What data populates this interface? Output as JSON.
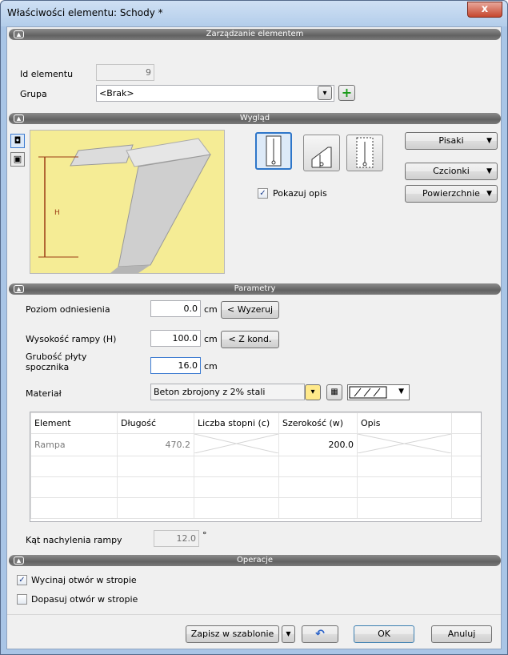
{
  "window": {
    "title": "Właściwości elementu: Schody *",
    "close_glyph": "x"
  },
  "sections": {
    "management": "Zarządzanie elementem",
    "appearance": "Wygląd",
    "parameters": "Parametry",
    "operations": "Operacje"
  },
  "management": {
    "id_label": "Id elementu",
    "id_value": "9",
    "group_label": "Grupa",
    "group_value": "<Brak>"
  },
  "appearance": {
    "preview_h_label": "H",
    "show_desc_label": "Pokazuj opis",
    "show_desc_checked": true,
    "pens_label": "Pisaki",
    "fonts_label": "Czcionki",
    "surfaces_label": "Powierzchnie"
  },
  "parameters": {
    "level_label": "Poziom odniesienia",
    "level_value": "0.0",
    "level_unit": "cm",
    "reset_button": "< Wyzeruj",
    "height_label": "Wysokość rampy (H)",
    "height_value": "100.0",
    "height_unit": "cm",
    "cond_button": "< Z kond.",
    "thickness_label_1": "Grubość płyty",
    "thickness_label_2": "spocznika",
    "thickness_value": "16.0",
    "thickness_unit": "cm",
    "material_label": "Materiał",
    "material_value": "Beton zbrojony z 2% stali",
    "table": {
      "headers": [
        "Element",
        "Długość",
        "Liczba stopni (c)",
        "Szerokość (w)",
        "Opis",
        ""
      ],
      "rows": [
        {
          "element": "Rampa",
          "length": "470.2",
          "steps": "",
          "width": "200.0",
          "desc": ""
        }
      ]
    },
    "slope_label": "Kąt nachylenia rampy",
    "slope_value": "12.0",
    "slope_unit": "°"
  },
  "operations": {
    "cut_label": "Wycinaj otwór w stropie",
    "cut_checked": true,
    "fit_label": "Dopasuj otwór w stropie",
    "fit_checked": false
  },
  "footer": {
    "save_template": "Zapisz w szablonie",
    "ok": "OK",
    "cancel": "Anuluj"
  }
}
